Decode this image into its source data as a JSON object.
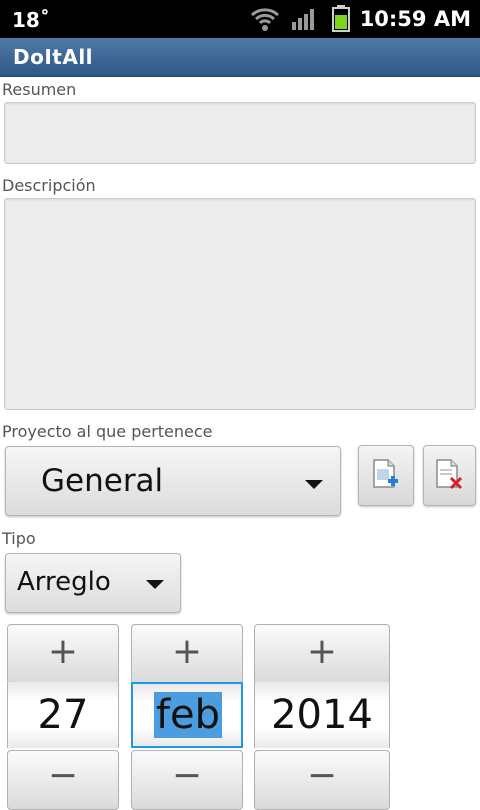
{
  "status_bar": {
    "temperature": "18˚",
    "time": "10:59 AM"
  },
  "app": {
    "title": "DoItAll"
  },
  "form": {
    "summary": {
      "label": "Resumen",
      "value": ""
    },
    "description": {
      "label": "Descripción",
      "value": ""
    },
    "project": {
      "label": "Proyecto al que pertenece",
      "selected": "General"
    },
    "type": {
      "label": "Tipo",
      "selected": "Arreglo"
    },
    "date": {
      "day": "27",
      "month": "feb",
      "year": "2014",
      "increment": "+",
      "decrement": "−"
    }
  },
  "icons": {
    "add_project": "add-document-icon",
    "delete_project": "delete-document-icon"
  },
  "colors": {
    "title_bar": "#3b6796",
    "focus": "#1e9ae0",
    "battery": "#7ed321"
  }
}
